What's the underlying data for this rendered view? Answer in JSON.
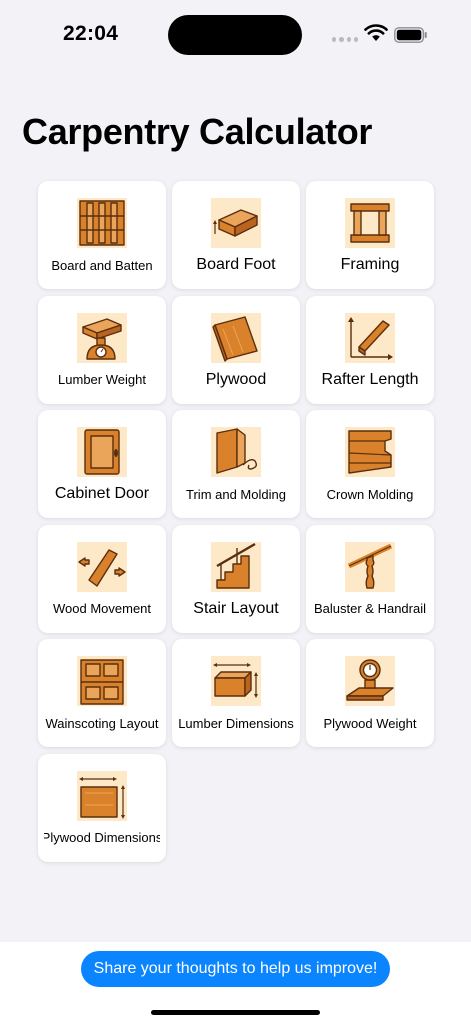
{
  "status_bar": {
    "time": "22:04"
  },
  "page": {
    "title": "Carpentry Calculator"
  },
  "tools": [
    {
      "label": "Board and Batten",
      "icon": "board-and-batten-icon",
      "large": false
    },
    {
      "label": "Board Foot",
      "icon": "board-foot-icon",
      "large": true
    },
    {
      "label": "Framing",
      "icon": "framing-icon",
      "large": true
    },
    {
      "label": "Lumber Weight",
      "icon": "lumber-weight-icon",
      "large": false
    },
    {
      "label": "Plywood",
      "icon": "plywood-icon",
      "large": true
    },
    {
      "label": "Rafter Length",
      "icon": "rafter-length-icon",
      "large": true
    },
    {
      "label": "Cabinet Door",
      "icon": "cabinet-door-icon",
      "large": true
    },
    {
      "label": "Trim and Molding",
      "icon": "trim-and-molding-icon",
      "large": false
    },
    {
      "label": "Crown Molding",
      "icon": "crown-molding-icon",
      "large": false
    },
    {
      "label": "Wood Movement",
      "icon": "wood-movement-icon",
      "large": false
    },
    {
      "label": "Stair Layout",
      "icon": "stair-layout-icon",
      "large": true
    },
    {
      "label": "Baluster & Handrail",
      "icon": "baluster-handrail-icon",
      "large": false
    },
    {
      "label": "Wainscoting Layout",
      "icon": "wainscoting-icon",
      "large": false
    },
    {
      "label": "Lumber Dimensions",
      "icon": "lumber-dimensions-icon",
      "large": false
    },
    {
      "label": "Plywood Weight",
      "icon": "plywood-weight-icon",
      "large": false
    },
    {
      "label": "Plywood Dimensions",
      "icon": "plywood-dimensions-icon",
      "large": false
    }
  ],
  "footer": {
    "feedback_label": "Share your thoughts to help us improve!"
  },
  "colors": {
    "accent": "#0a84ff",
    "icon_bg": "#fde8c7",
    "wood": "#d9822b",
    "wood_dark": "#5a2e0e"
  }
}
